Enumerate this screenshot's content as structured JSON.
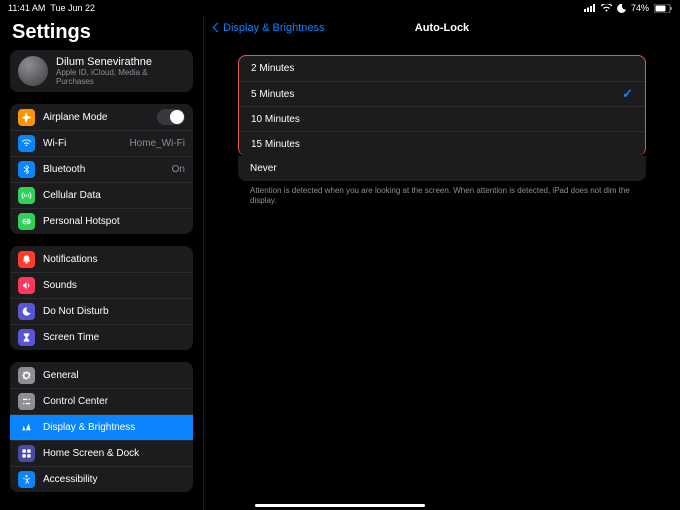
{
  "status": {
    "time": "11:41 AM",
    "date": "Tue Jun 22",
    "battery_pct": "74%"
  },
  "sidebar": {
    "title": "Settings",
    "profile": {
      "name": "Dilum Senevirathne",
      "sub": "Apple ID, iCloud, Media & Purchases"
    },
    "g1": {
      "airplane": "Airplane Mode",
      "wifi": "Wi-Fi",
      "wifi_detail": "Home_Wi-Fi",
      "bt": "Bluetooth",
      "bt_detail": "On",
      "cell": "Cellular Data",
      "hotspot": "Personal Hotspot"
    },
    "g2": {
      "notif": "Notifications",
      "sounds": "Sounds",
      "dnd": "Do Not Disturb",
      "screentime": "Screen Time"
    },
    "g3": {
      "general": "General",
      "control": "Control Center",
      "display": "Display & Brightness",
      "home": "Home Screen & Dock",
      "access": "Accessibility"
    }
  },
  "detail": {
    "back": "Display & Brightness",
    "title": "Auto-Lock",
    "options": {
      "o0": "2 Minutes",
      "o1": "5 Minutes",
      "o2": "10 Minutes",
      "o3": "15 Minutes",
      "never": "Never"
    },
    "selected_index": 1,
    "footnote": "Attention is detected when you are looking at the screen. When attention is detected, iPad does not dim the display."
  },
  "colors": {
    "accent": "#0a84ff",
    "highlight_border": "#e45a53",
    "icon": {
      "airplane": "#ff9500",
      "wifi": "#0a84ff",
      "bt": "#0a84ff",
      "cell": "#30d158",
      "hotspot": "#30d158",
      "notif": "#ff3b30",
      "sounds": "#ff375f",
      "dnd": "#5856d6",
      "screentime": "#5856d6",
      "general": "#8e8e93",
      "control": "#8e8e93",
      "display": "#0a84ff",
      "home": "#4b4ba7",
      "access": "#0a84ff"
    }
  }
}
